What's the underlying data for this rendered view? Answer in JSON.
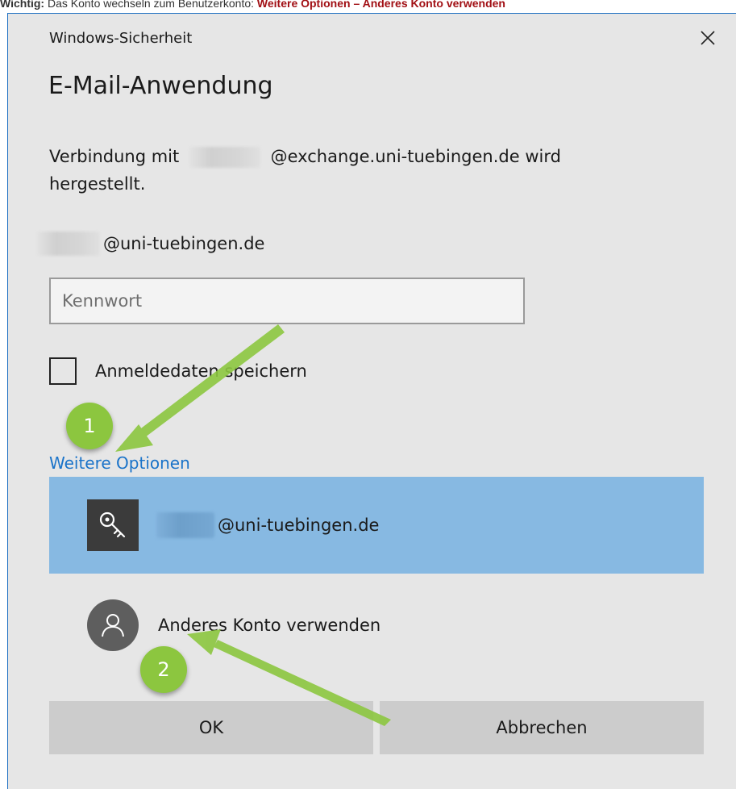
{
  "note": {
    "prefix": "Wichtig:",
    "text": "Das Konto wechseln zum Benutzerkonto:",
    "path": "Weitere Optionen – Anderes Konto verwenden"
  },
  "window": {
    "title": "Windows-Sicherheit",
    "close_glyph": "✕"
  },
  "dialog": {
    "heading": "E-Mail-Anwendung",
    "desc_before": "Verbindung mit",
    "desc_after": "@exchange.uni-tuebingen.de wird hergestellt.",
    "user_domain": "@uni-tuebingen.de",
    "password_placeholder": "Kennwort",
    "remember_label": "Anmeldedaten speichern",
    "more_options": "Weitere Optionen"
  },
  "accounts": {
    "selected_domain": "@uni-tuebingen.de",
    "selected_icon": "key-icon",
    "other_label": "Anderes Konto verwenden",
    "other_icon": "person-icon"
  },
  "buttons": {
    "ok": "OK",
    "cancel": "Abbrechen"
  },
  "annotations": {
    "badge1": "1",
    "badge2": "2"
  },
  "colors": {
    "dialog_bg": "#e6e6e6",
    "selected_bg": "#87b9e2",
    "link": "#1a73c9",
    "arrow": "#8cc63f",
    "note_highlight": "#a10f14"
  }
}
